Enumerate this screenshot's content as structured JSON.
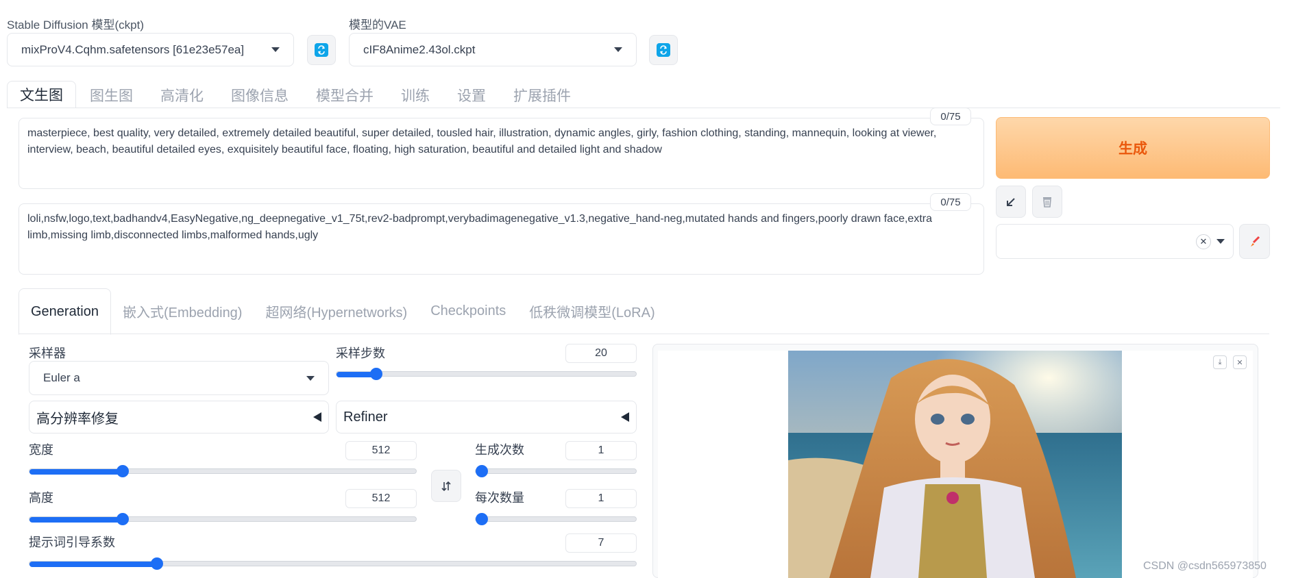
{
  "model": {
    "ckpt_label": "Stable Diffusion 模型(ckpt)",
    "ckpt_value": "mixProV4.Cqhm.safetensors [61e23e57ea]",
    "vae_label": "模型的VAE",
    "vae_value": "cIF8Anime2.43ol.ckpt"
  },
  "main_tabs": [
    "文生图",
    "图生图",
    "高清化",
    "图像信息",
    "模型合并",
    "训练",
    "设置",
    "扩展插件"
  ],
  "prompt": {
    "text": "masterpiece, best quality, very detailed, extremely detailed beautiful, super detailed, tousled hair, illustration, dynamic angles, girly, fashion clothing, standing, mannequin, looking at viewer, interview, beach, beautiful detailed eyes, exquisitely beautiful face, floating, high saturation, beautiful and detailed light and shadow",
    "counter": "0/75"
  },
  "negative_prompt": {
    "text": "loli,nsfw,logo,text,badhandv4,EasyNegative,ng_deepnegative_v1_75t,rev2-badprompt,verybadimagenegative_v1.3,negative_hand-neg,mutated hands and fingers,poorly drawn face,extra limb,missing limb,disconnected limbs,malformed hands,ugly",
    "counter": "0/75"
  },
  "generate_label": "生成",
  "sub_tabs": [
    "Generation",
    "嵌入式(Embedding)",
    "超网络(Hypernetworks)",
    "Checkpoints",
    "低秩微调模型(LoRA)"
  ],
  "sampler": {
    "label": "采样器",
    "value": "Euler a"
  },
  "steps": {
    "label": "采样步数",
    "value": "20",
    "level": 0.133
  },
  "hires": {
    "label": "高分辨率修复"
  },
  "refiner": {
    "label": "Refiner"
  },
  "width": {
    "label": "宽度",
    "value": "512",
    "level": 0.24
  },
  "height": {
    "label": "高度",
    "value": "512",
    "level": 0.24
  },
  "batch_count": {
    "label": "生成次数",
    "value": "1",
    "level": 0.0
  },
  "batch_size": {
    "label": "每次数量",
    "value": "1",
    "level": 0.0
  },
  "cfg": {
    "label": "提示词引导系数",
    "value": "7",
    "level": 0.21
  },
  "watermark": "CSDN @csdn565973850",
  "colors": {
    "accent": "#1d6ef5",
    "generate_text": "#ea580c"
  }
}
